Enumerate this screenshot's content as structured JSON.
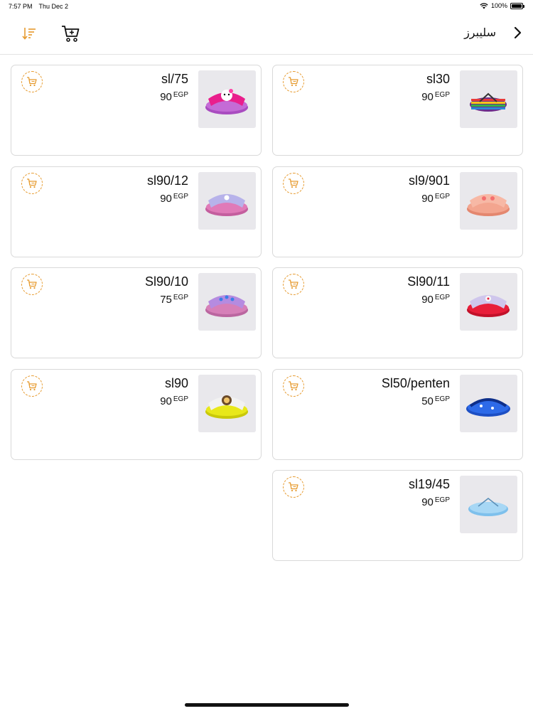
{
  "status": {
    "time": "7:57 PM",
    "date": "Thu Dec 2",
    "battery": "100%"
  },
  "header": {
    "title": "سليبرز"
  },
  "colors": {
    "accent": "#e69a2e",
    "card_border": "#d9d9d9",
    "thumb_bg": "#e9e8ec"
  },
  "products": [
    {
      "name": "sl30",
      "price": "90",
      "currency": "EGP",
      "image": "striped-flip-flops"
    },
    {
      "name": "sl/75",
      "price": "90",
      "currency": "EGP",
      "image": "pink-character-slides"
    },
    {
      "name": "sl9/901",
      "price": "90",
      "currency": "EGP",
      "image": "peach-slides"
    },
    {
      "name": "sl90/12",
      "price": "90",
      "currency": "EGP",
      "image": "lilac-pink-slides"
    },
    {
      "name": "Sl90/11",
      "price": "90",
      "currency": "EGP",
      "image": "red-slides"
    },
    {
      "name": "Sl90/10",
      "price": "75",
      "currency": "EGP",
      "image": "lilac-flower-slides"
    },
    {
      "name": "Sl50/penten",
      "price": "50",
      "currency": "EGP",
      "image": "blue-strap-sandals"
    },
    {
      "name": "sl90",
      "price": "90",
      "currency": "EGP",
      "image": "yellow-slides"
    },
    {
      "name": "sl19/45",
      "price": "90",
      "currency": "EGP",
      "image": "light-blue-flip-flops"
    }
  ]
}
